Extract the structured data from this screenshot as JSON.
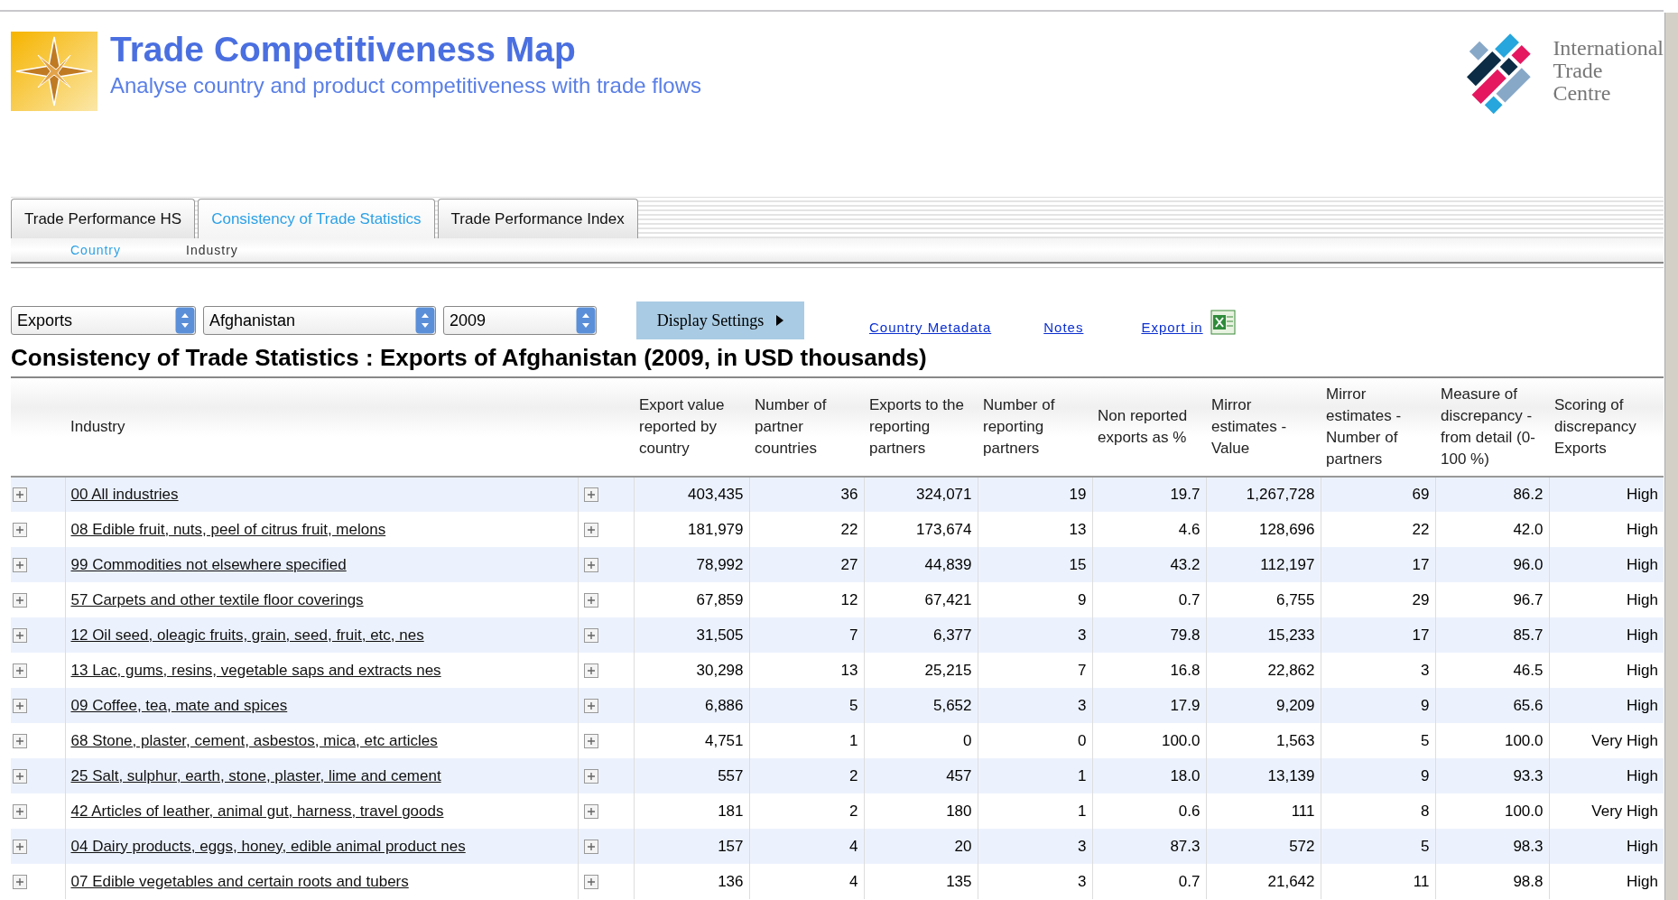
{
  "header": {
    "title": "Trade Competitiveness Map",
    "subtitle": "Analyse country and product competitiveness with trade flows",
    "org_logo_lines": [
      "International",
      "Trade",
      "Centre"
    ]
  },
  "tabs": [
    {
      "label": "Trade Performance HS",
      "selected": false
    },
    {
      "label": "Consistency of Trade Statistics",
      "selected": true
    },
    {
      "label": "Trade Performance Index",
      "selected": false
    }
  ],
  "subtabs": [
    {
      "label": "Country",
      "selected": true
    },
    {
      "label": "Industry",
      "selected": false
    }
  ],
  "filters": [
    {
      "value": "Exports"
    },
    {
      "value": "Afghanistan"
    },
    {
      "value": "2009"
    }
  ],
  "display_settings": {
    "label": "Display Settings"
  },
  "links": [
    {
      "label": "Country Metadata"
    },
    {
      "label": "Notes"
    },
    {
      "label": "Export in",
      "icon": true
    }
  ],
  "page_title": "Consistency of Trade Statistics : Exports of Afghanistan (2009, in USD thousands)",
  "table": {
    "columns": [
      "Industry",
      "Export value reported by country",
      "Number of partner countries",
      "Exports to the reporting partners",
      "Number of reporting partners",
      "Non reported exports as %",
      "Mirror estimates - Value",
      "Mirror estimates - Number of partners",
      "Measure of discrepancy - from detail (0-100 %)",
      "Scoring of discrepancy Exports"
    ],
    "rows": [
      [
        "00 All industries",
        "403,435",
        "36",
        "324,071",
        "19",
        "19.7",
        "1,267,728",
        "69",
        "86.2",
        "High"
      ],
      [
        "08 Edible fruit, nuts, peel of citrus fruit, melons",
        "181,979",
        "22",
        "173,674",
        "13",
        "4.6",
        "128,696",
        "22",
        "42.0",
        "High"
      ],
      [
        "99 Commodities not elsewhere specified",
        "78,992",
        "27",
        "44,839",
        "15",
        "43.2",
        "112,197",
        "17",
        "96.0",
        "High"
      ],
      [
        "57 Carpets and other textile floor coverings",
        "67,859",
        "12",
        "67,421",
        "9",
        "0.7",
        "6,755",
        "29",
        "96.7",
        "High"
      ],
      [
        "12 Oil seed, oleagic fruits, grain, seed, fruit, etc, nes",
        "31,505",
        "7",
        "6,377",
        "3",
        "79.8",
        "15,233",
        "17",
        "85.7",
        "High"
      ],
      [
        "13 Lac, gums, resins, vegetable saps and extracts nes",
        "30,298",
        "13",
        "25,215",
        "7",
        "16.8",
        "22,862",
        "3",
        "46.5",
        "High"
      ],
      [
        "09 Coffee, tea, mate and spices",
        "6,886",
        "5",
        "5,652",
        "3",
        "17.9",
        "9,209",
        "9",
        "65.6",
        "High"
      ],
      [
        "68 Stone, plaster, cement, asbestos, mica, etc articles",
        "4,751",
        "1",
        "0",
        "0",
        "100.0",
        "1,563",
        "5",
        "100.0",
        "Very High"
      ],
      [
        "25 Salt, sulphur, earth, stone, plaster, lime and cement",
        "557",
        "2",
        "457",
        "1",
        "18.0",
        "13,139",
        "9",
        "93.3",
        "High"
      ],
      [
        "42 Articles of leather, animal gut, harness, travel goods",
        "181",
        "2",
        "180",
        "1",
        "0.6",
        "111",
        "8",
        "100.0",
        "Very High"
      ],
      [
        "04 Dairy products, eggs, honey, edible animal product nes",
        "157",
        "4",
        "20",
        "3",
        "87.3",
        "572",
        "5",
        "98.3",
        "High"
      ],
      [
        "07 Edible vegetables and certain roots and tubers",
        "136",
        "4",
        "135",
        "3",
        "0.7",
        "21,642",
        "11",
        "98.8",
        "High"
      ]
    ]
  }
}
